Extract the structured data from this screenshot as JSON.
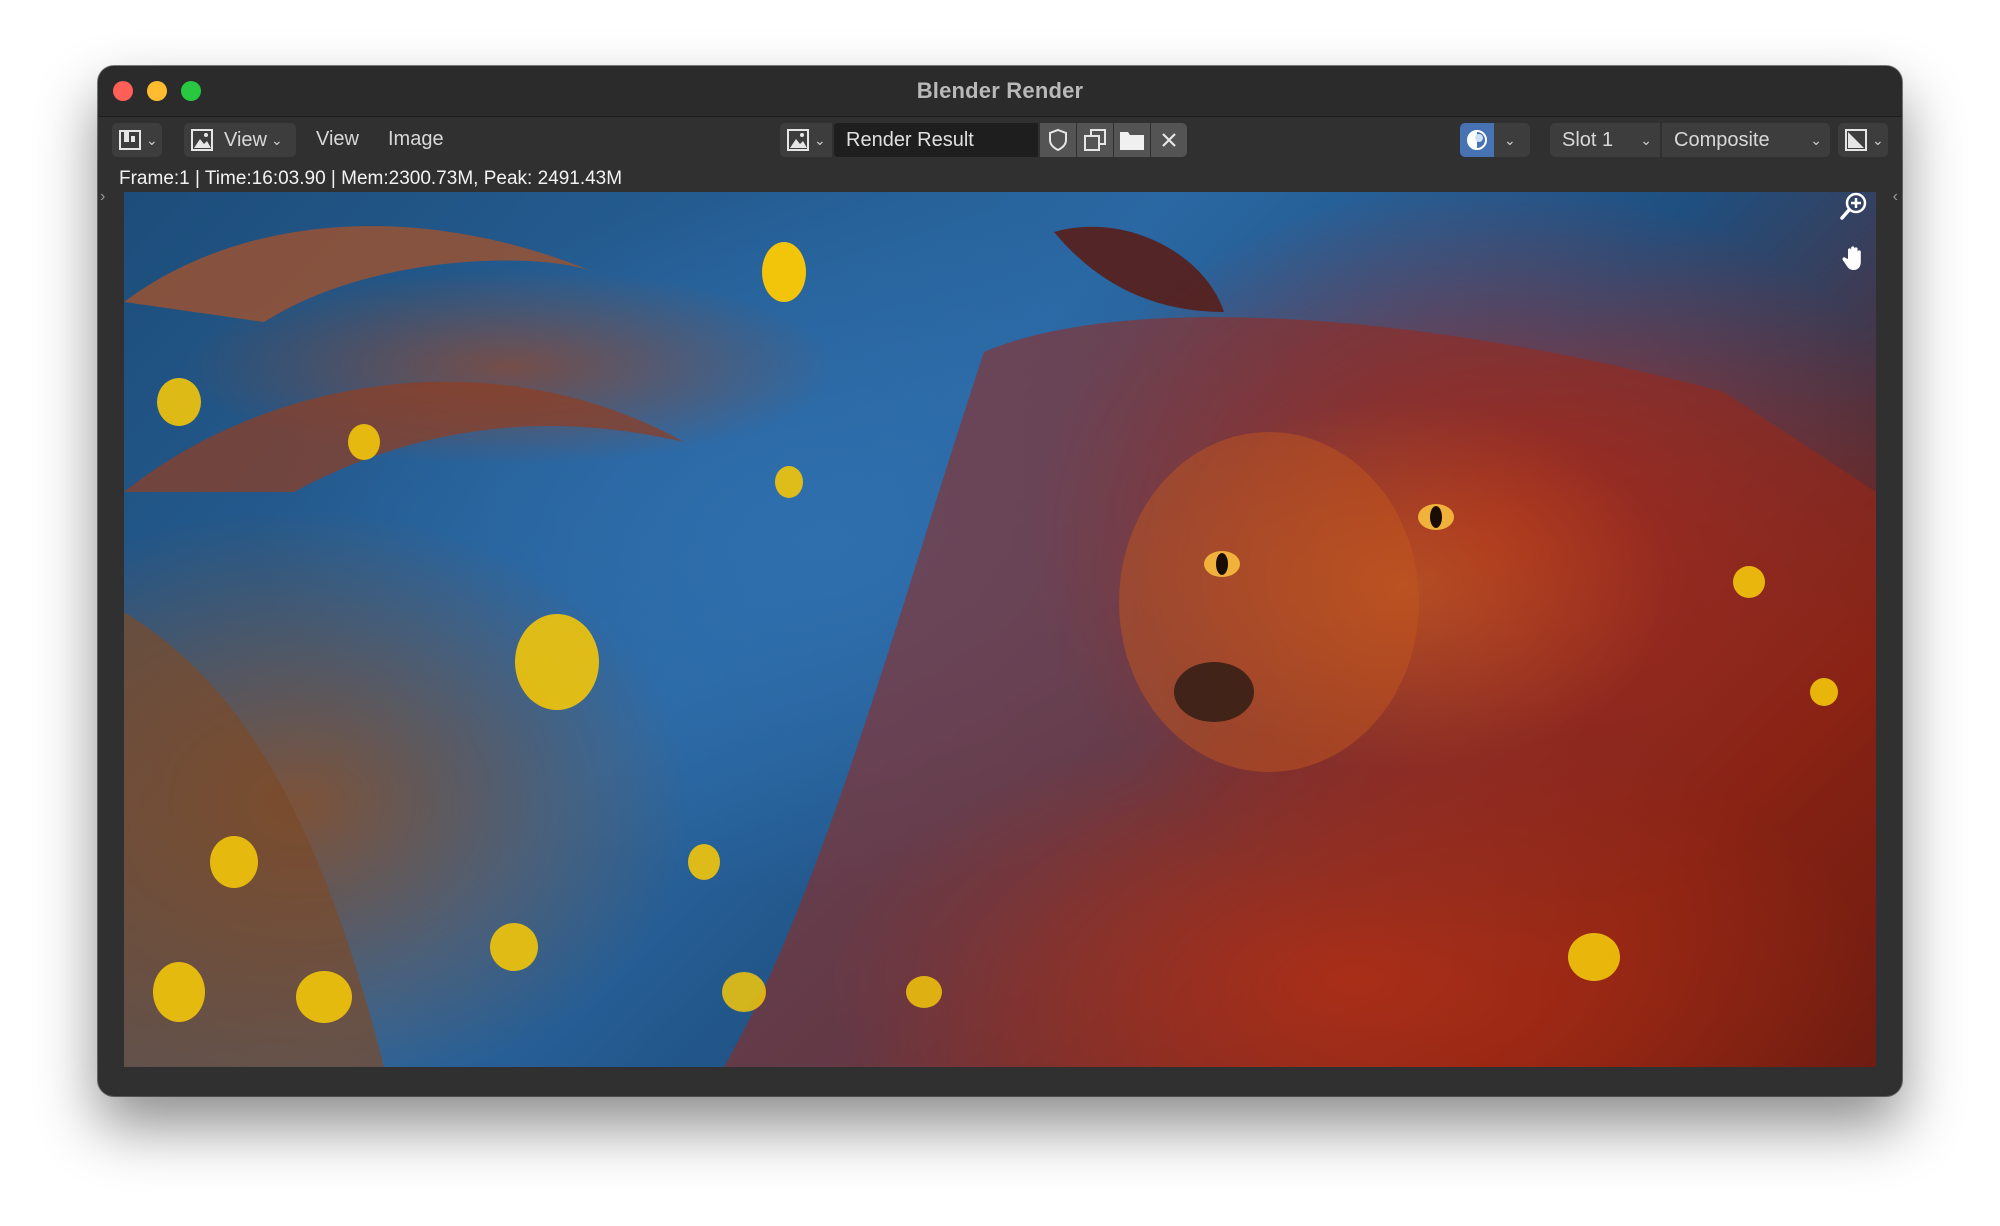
{
  "window": {
    "title": "Blender Render"
  },
  "header": {
    "editor_type_icon": "image-editor-icon",
    "view_mode_icon": "image-icon",
    "view_mode_label": "View",
    "menus": [
      "View",
      "Image"
    ],
    "image_browse_icon": "image-icon",
    "image_name": "Render Result",
    "slot": "Slot 1",
    "layer": "Composite"
  },
  "status": {
    "text": "Frame:1 | Time:16:03.90 | Mem:2300.73M, Peak: 2491.43M"
  },
  "colors": {
    "accent": "#4772b3",
    "window_bg": "#303030",
    "field_bg": "#1e1e1e"
  }
}
